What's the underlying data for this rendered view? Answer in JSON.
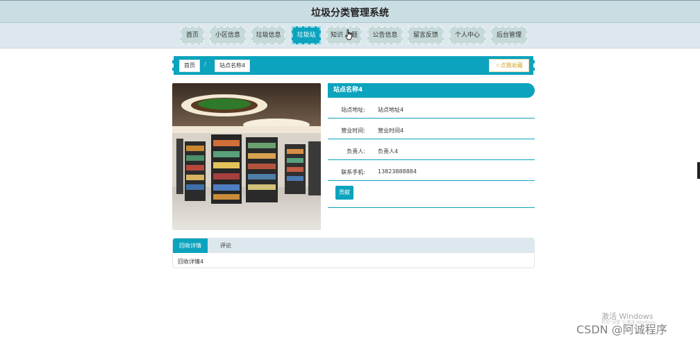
{
  "header": {
    "title": "垃圾分类管理系统"
  },
  "nav": {
    "items": [
      {
        "label": "首页",
        "active": false
      },
      {
        "label": "小区信息",
        "active": false
      },
      {
        "label": "垃圾信息",
        "active": false
      },
      {
        "label": "垃圾站",
        "active": true
      },
      {
        "label": "知识",
        "label2": "题",
        "active": false
      },
      {
        "label": "公告信息",
        "active": false
      },
      {
        "label": "留言反馈",
        "active": false
      },
      {
        "label": "个人中心",
        "active": false
      },
      {
        "label": "后台管理",
        "active": false
      }
    ]
  },
  "breadcrumb": {
    "home": "首页",
    "separator": "/",
    "current": "站点名称4"
  },
  "favorite": {
    "label": "点我收藏",
    "icon": "star-icon"
  },
  "station": {
    "name": "站点名称4",
    "fields": [
      {
        "label": "站点地址:",
        "value": "站点地址4"
      },
      {
        "label": "营业时间:",
        "value": "营业时间4"
      },
      {
        "label": "负责人:",
        "value": "负责人4"
      },
      {
        "label": "联系手机:",
        "value": "13823888884"
      }
    ],
    "contribute_label": "贡献"
  },
  "tabs": {
    "items": [
      {
        "label": "回收详情",
        "active": true
      },
      {
        "label": "评论",
        "active": false
      }
    ],
    "content": "回收详情4"
  },
  "watermarks": {
    "activate": "激活 Windows",
    "activate_sub": "转到“设置”以激活 Windows。",
    "csdn": "CSDN @阿诚程序"
  },
  "colors": {
    "accent": "#0ba3bd",
    "header_bg": "#c9dde3",
    "nav_bg": "#dde7ee",
    "favorite": "#d7a11c"
  }
}
